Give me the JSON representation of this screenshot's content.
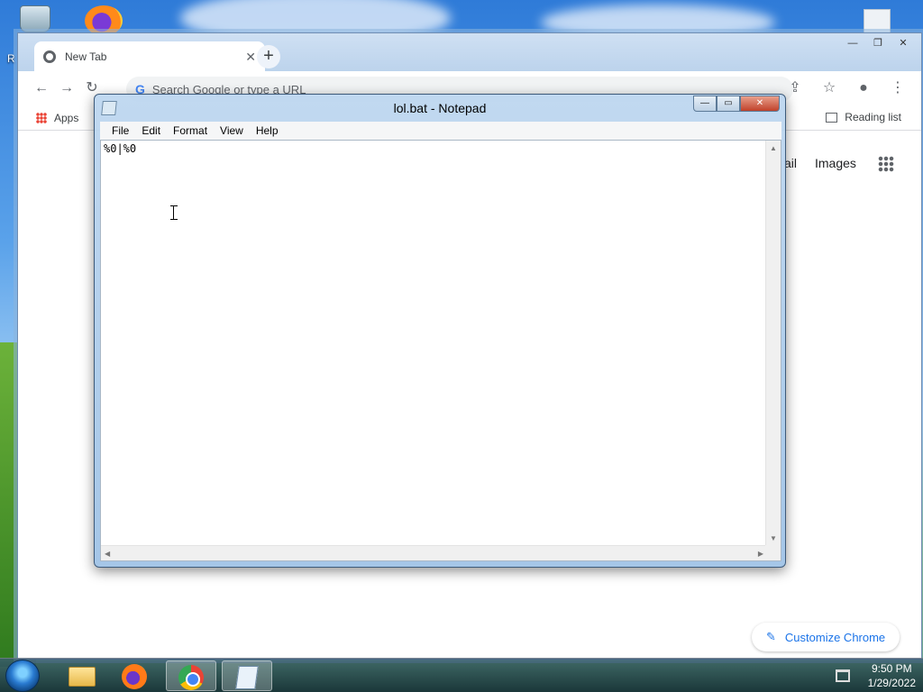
{
  "desktop": {
    "icon_label_partial": "R"
  },
  "chrome": {
    "tab_title": "New Tab",
    "tab_close_glyph": "✕",
    "new_tab_glyph": "+",
    "window_controls": {
      "minimize": "—",
      "restore": "❐",
      "close": "✕"
    },
    "toolbar": {
      "back_glyph": "←",
      "forward_glyph": "→",
      "reload_glyph": "↻",
      "google_logo": "G",
      "omnibox_placeholder": "Search Google or type a URL",
      "share_glyph": "⇪",
      "star_glyph": "☆",
      "profile_glyph": "●",
      "menu_glyph": "⋮"
    },
    "bookmarks": {
      "apps_label": "Apps",
      "reading_list_label": "Reading list"
    },
    "page": {
      "gmail_partial": "ail",
      "images_label": "Images",
      "customize_label": "Customize Chrome",
      "customize_glyph": "✎"
    }
  },
  "notepad": {
    "title": "lol.bat - Notepad",
    "window_controls": {
      "minimize": "—",
      "maximize": "▭",
      "close": "✕"
    },
    "menus": [
      "File",
      "Edit",
      "Format",
      "View",
      "Help"
    ],
    "content": "%0|%0",
    "scroll_up": "▲",
    "scroll_down": "▼",
    "scroll_left": "◀",
    "scroll_right": "▶"
  },
  "taskbar": {
    "apps": [
      "explorer",
      "firefox",
      "chrome",
      "notepad"
    ],
    "active_app": "notepad",
    "time": "9:50 PM",
    "date": "1/29/2022"
  }
}
